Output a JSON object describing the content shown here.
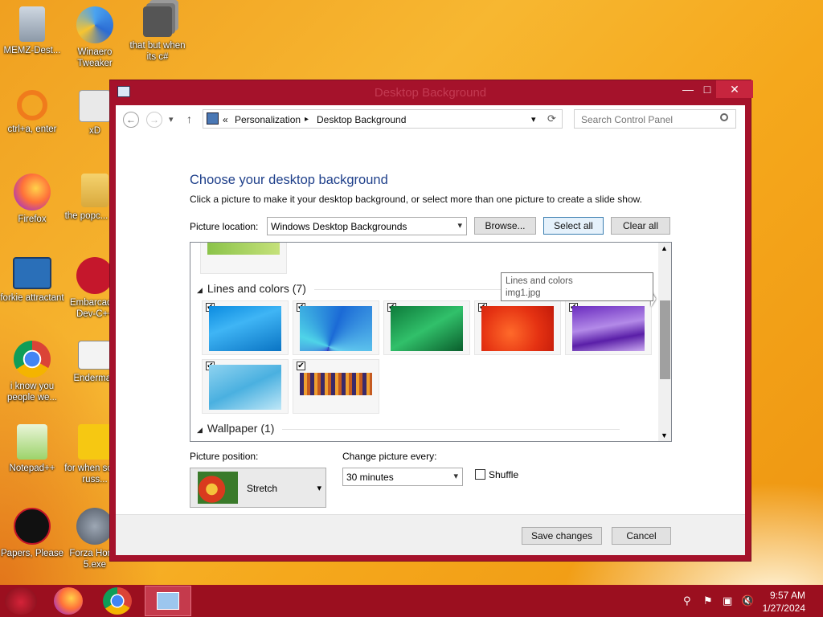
{
  "desktop": {
    "icons": [
      {
        "label": "MEMZ-Dest..."
      },
      {
        "label": "Winaero Tweaker"
      },
      {
        "label": "that but when its c#"
      },
      {
        "label": "ctrl+a, enter"
      },
      {
        "label": "xD"
      },
      {
        "label": "Firefox"
      },
      {
        "label": "the popc... shit"
      },
      {
        "label": "forkie attractant"
      },
      {
        "label": "Embarcad... Dev-C++"
      },
      {
        "label": "i know you people we..."
      },
      {
        "label": "Enderman"
      },
      {
        "label": "Notepad++"
      },
      {
        "label": "for when some russ..."
      },
      {
        "label": "Papers, Please"
      },
      {
        "label": "Forza Hori... 5.exe"
      }
    ]
  },
  "window": {
    "title": "Desktop Background",
    "close_glyph": "✕",
    "min_glyph": "—",
    "max_glyph": "□"
  },
  "nav": {
    "back_glyph": "←",
    "forward_glyph": "→",
    "recent_glyph": "▾",
    "up_glyph": "↑",
    "breadcrumb_prefix": "«",
    "crumbs": [
      "Personalization",
      "Desktop Background"
    ],
    "crumb_sep": "▸",
    "refresh_glyph": "⟳",
    "search_placeholder": "Search Control Panel"
  },
  "content": {
    "heading": "Choose your desktop background",
    "subtext": "Click a picture to make it your desktop background, or select more than one picture to create a slide show.",
    "location_label": "Picture location:",
    "location_value": "Windows Desktop Backgrounds",
    "browse_label": "Browse...",
    "select_all_label": "Select all",
    "clear_all_label": "Clear all",
    "groups": [
      {
        "name": "Lines and colors (7)"
      },
      {
        "name": "Wallpaper (1)"
      }
    ],
    "tooltip": {
      "line1": "Lines and colors",
      "line2": "img1.jpg"
    },
    "check_glyph": "✔",
    "position_label": "Picture position:",
    "position_value": "Stretch",
    "change_label": "Change picture every:",
    "change_value": "30 minutes",
    "shuffle_label": "Shuffle"
  },
  "footer": {
    "save_label": "Save changes",
    "cancel_label": "Cancel"
  },
  "taskbar": {
    "time": "9:57 AM",
    "date": "1/27/2024"
  },
  "colors": {
    "titlebar": "#a5122b",
    "taskbar": "#9b0f1f",
    "heading": "#1e3f8a"
  }
}
